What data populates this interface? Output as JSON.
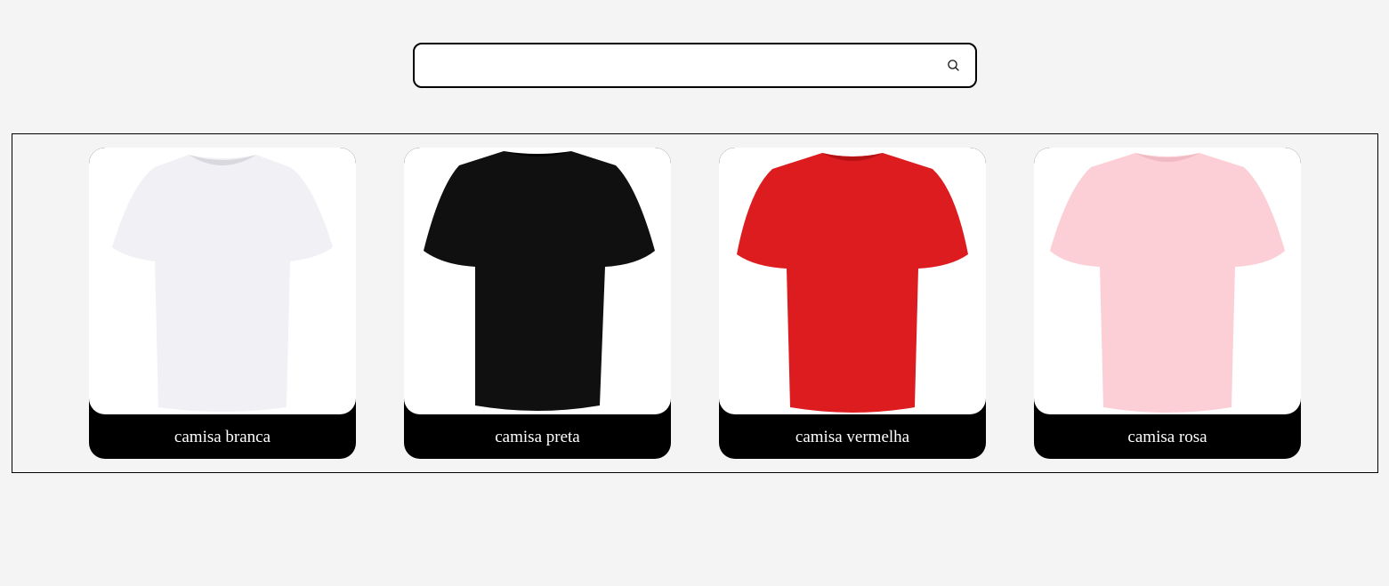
{
  "search": {
    "value": "",
    "placeholder": "",
    "icon": "search-icon"
  },
  "products": [
    {
      "label": "camisa branca",
      "color": "#f1f0f4",
      "shade": "#d9d8de",
      "image": "white-tshirt"
    },
    {
      "label": "camisa preta",
      "color": "#101010",
      "shade": "#000000",
      "image": "black-tshirt"
    },
    {
      "label": "camisa vermelha",
      "color": "#dc1c1f",
      "shade": "#b51215",
      "image": "red-tshirt"
    },
    {
      "label": "camisa rosa",
      "color": "#fccfd6",
      "shade": "#f1b9c2",
      "image": "pink-tshirt"
    }
  ]
}
